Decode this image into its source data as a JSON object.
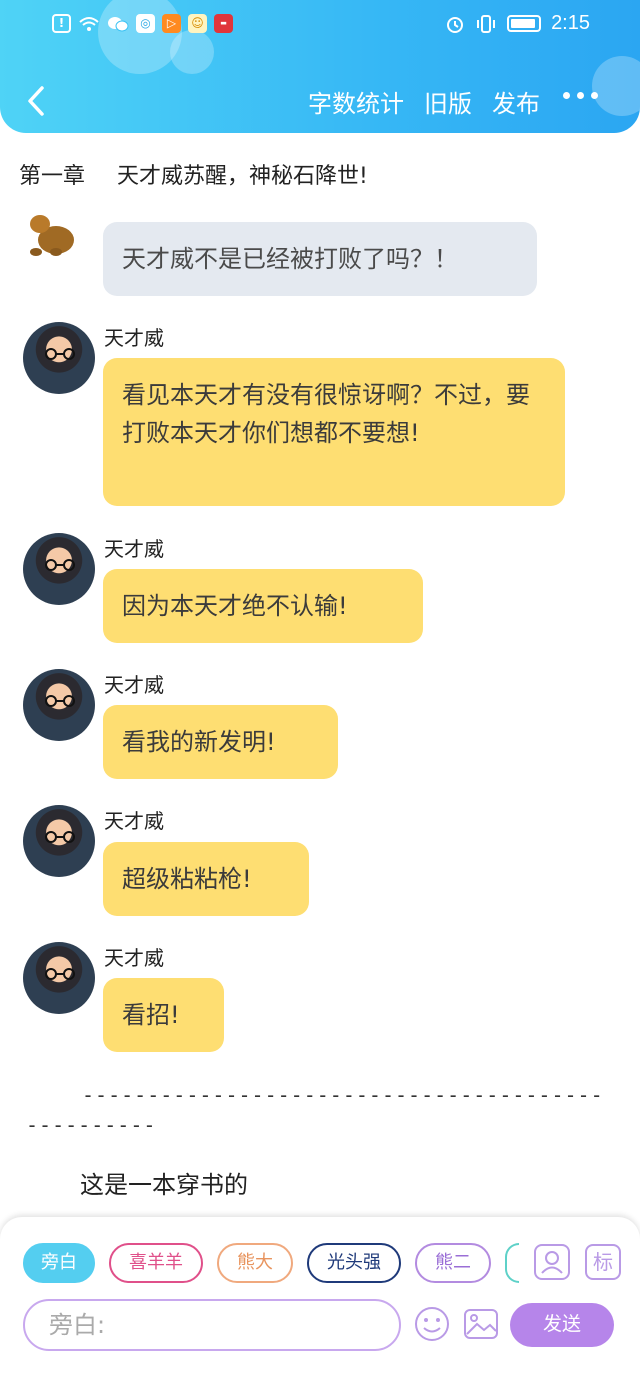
{
  "status_bar": {
    "time": "2:15",
    "left_icons": [
      "alert-icon",
      "wifi-icon",
      "wechat-icon",
      "bulb-app-icon",
      "video-app-icon",
      "face-app-icon",
      "huawei-app-icon"
    ],
    "right_icons": [
      "alarm-icon",
      "vibrate-icon",
      "battery-icon"
    ]
  },
  "nav": {
    "word_count": "字数统计",
    "old_version": "旧版",
    "publish": "发布"
  },
  "chapter": {
    "number": "第一章",
    "title": "天才威苏醒，神秘石降世!"
  },
  "messages": [
    {
      "speaker": "",
      "text": "天才威不是已经被打败了吗？！",
      "style": "gray"
    },
    {
      "speaker": "天才威",
      "text": "看见本天才有没有很惊讶啊？不过，要打败本天才你们想都不要想!"
    },
    {
      "speaker": "天才威",
      "text": "因为本天才绝不认输!"
    },
    {
      "speaker": "天才威",
      "text": "看我的新发明!"
    },
    {
      "speaker": "天才威",
      "text": "超级粘粘枪!"
    },
    {
      "speaker": "天才威",
      "text": "看招!"
    }
  ],
  "divider": "--------------------------------------------------",
  "paragraph": "这是一本穿书的",
  "panel": {
    "chips": [
      {
        "label": "旁白",
        "active": true,
        "color": "#54cef0"
      },
      {
        "label": "喜羊羊",
        "color": "#e0508a"
      },
      {
        "label": "熊大",
        "color": "#f0a97e"
      },
      {
        "label": "光头强",
        "color": "#1f3a7a"
      },
      {
        "label": "熊二",
        "color": "#b38be0"
      }
    ],
    "avatar_tool_icon": "person-icon",
    "tag_tool_label": "标",
    "input_placeholder": "旁白:",
    "send_label": "发送",
    "accent_color": "#b685ea"
  }
}
